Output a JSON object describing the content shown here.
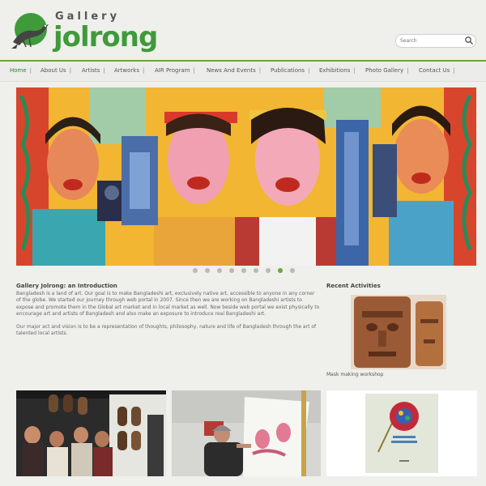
{
  "header": {
    "logo_top": "Gallery",
    "logo_bottom": "jolrong",
    "search_placeholder": "Search"
  },
  "nav": {
    "items": [
      {
        "label": "Home",
        "active": true
      },
      {
        "label": "About Us"
      },
      {
        "label": "Artists"
      },
      {
        "label": "Artworks"
      },
      {
        "label": "AIR Program"
      },
      {
        "label": "News And Events"
      },
      {
        "label": "Publications"
      },
      {
        "label": "Exhibitions"
      },
      {
        "label": "Photo Gallery"
      },
      {
        "label": "Contact Us"
      }
    ],
    "separator": "|"
  },
  "slider": {
    "dot_count": 9,
    "active_dot": 7
  },
  "intro": {
    "title": "Gallery Jolrong: an Introduction",
    "paragraph1": "Bangladesh is a land of art. Our goal is to make Bangladeshi art, exclusively native art, accessible to anyone in any corner of the globe. We started our journey through web portal in 2007. Since then we are working on Bangladeshi artists to expose and promote them in the Global art market and in local market as well. Now beside web portal we exist physically to encourage art and artists of Bangladesh and also make an exposure to introduce real Bangladeshi art.",
    "paragraph2": "Our major act and vision is to be a representation of thoughts, philosophy, nature and life of Bangladesh through the art of talented local artists."
  },
  "recent": {
    "title": "Recent Activities",
    "caption": "Mask making workshop"
  },
  "colors": {
    "brand_green": "#3f9a3a",
    "nav_border": "#6aa63f",
    "background": "#efefec"
  }
}
